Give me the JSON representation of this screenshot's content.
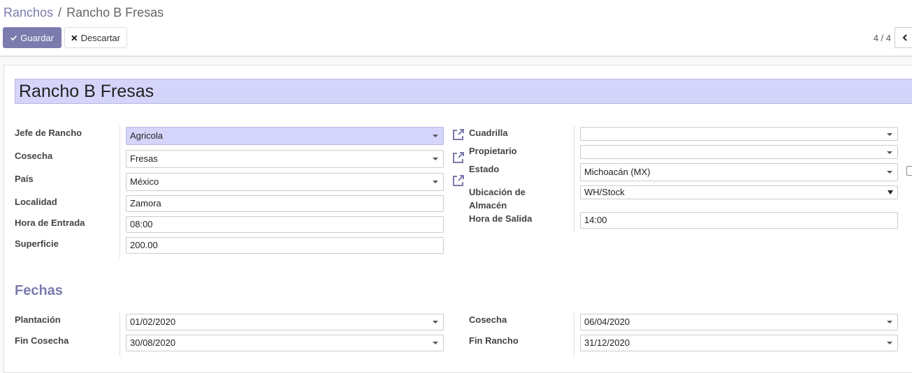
{
  "breadcrumb": {
    "parent": "Ranchos",
    "separator": "/",
    "current": "Rancho B Fresas"
  },
  "toolbar": {
    "save_label": "Guardar",
    "discard_label": "Descartar"
  },
  "pager": {
    "text": "4 / 4"
  },
  "record": {
    "name": "Rancho B Fresas"
  },
  "left_fields": {
    "jefe_label": "Jefe de Rancho",
    "jefe_value": "Agricola",
    "cosecha_label": "Cosecha",
    "cosecha_value": "Fresas",
    "pais_label": "País",
    "pais_value": "México",
    "localidad_label": "Localidad",
    "localidad_value": "Zamora",
    "hora_entrada_label": "Hora de Entrada",
    "hora_entrada_value": "08:00",
    "superficie_label": "Superficie",
    "superficie_value": "200.00"
  },
  "right_fields": {
    "cuadrilla_label": "Cuadrilla",
    "cuadrilla_value": "",
    "propietario_label": "Propietario",
    "propietario_value": "",
    "estado_label": "Estado",
    "estado_value": "Michoacán (MX)",
    "ubicacion_label_1": "Ubicación de",
    "ubicacion_label_2": "Almacén",
    "ubicacion_value": "WH/Stock",
    "hora_salida_label": "Hora de Salida",
    "hora_salida_value": "14:00"
  },
  "fechas": {
    "heading": "Fechas",
    "plantacion_label": "Plantación",
    "plantacion_value": "01/02/2020",
    "fin_cosecha_label": "Fin Cosecha",
    "fin_cosecha_value": "30/08/2020",
    "cosecha_label": "Cosecha",
    "cosecha_value": "06/04/2020",
    "fin_rancho_label": "Fin Rancho",
    "fin_rancho_value": "31/12/2020"
  },
  "colors": {
    "accent": "#7c7bad",
    "required_bg": "#d5d5fb"
  },
  "icons": {
    "save": "check-icon",
    "discard": "times-icon",
    "pager_prev": "chevron-left-icon",
    "external": "external-link-icon"
  }
}
